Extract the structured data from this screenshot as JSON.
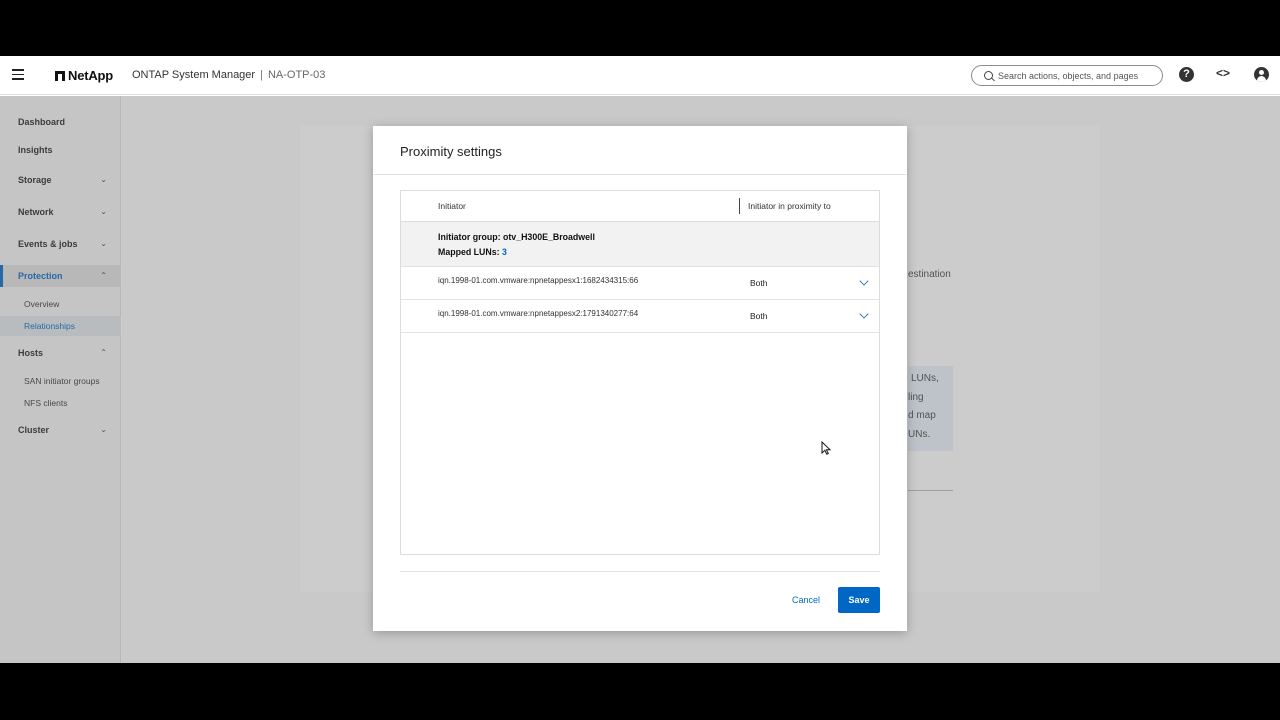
{
  "header": {
    "brand": "NetApp",
    "app_title": "ONTAP System Manager",
    "separator": "|",
    "cluster_name": "NA-OTP-03",
    "search_placeholder": "Search actions, objects, and pages",
    "help_glyph": "?",
    "code_glyph": "<>"
  },
  "sidebar": {
    "items": [
      {
        "label": "Dashboard",
        "chevron": ""
      },
      {
        "label": "Insights",
        "chevron": ""
      },
      {
        "label": "Storage",
        "chevron": "⌄"
      },
      {
        "label": "Network",
        "chevron": "⌄"
      },
      {
        "label": "Events & jobs",
        "chevron": "⌄"
      },
      {
        "label": "Protection",
        "chevron": "⌃"
      },
      {
        "label": "Hosts",
        "chevron": "⌃"
      },
      {
        "label": "Cluster",
        "chevron": "⌄"
      }
    ],
    "protection_sub": [
      "Overview",
      "Relationships"
    ],
    "hosts_sub": [
      "SAN initiator groups",
      "NFS clients"
    ]
  },
  "background": {
    "fragment_destination": "estination",
    "fragment_luns1": "LUNs,",
    "fragment_ling": "ling",
    "fragment_dmap": "d map",
    "fragment_luns2": "UNs."
  },
  "modal": {
    "title": "Proximity settings",
    "col_initiator": "Initiator",
    "col_proximity": "Initiator in proximity to",
    "group_name": "Initiator group: otv_H300E_Broadwell",
    "mapped_luns_label": "Mapped LUNs:",
    "mapped_luns_count": "3",
    "rows": [
      {
        "iqn": "iqn.1998-01.com.vmware:npnetappesx1:1682434315:66",
        "proximity": "Both"
      },
      {
        "iqn": "iqn.1998-01.com.vmware:npnetappesx2:1791340277:64",
        "proximity": "Both"
      }
    ],
    "cancel_label": "Cancel",
    "save_label": "Save"
  },
  "colors": {
    "accent": "#0067c5"
  }
}
